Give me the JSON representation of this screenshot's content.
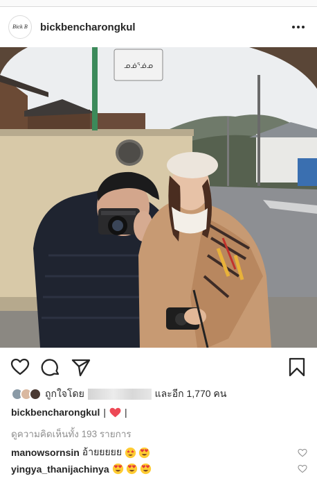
{
  "post": {
    "username": "bickbencharongkul",
    "avatar_text": "Bick B",
    "more_icon": "ellipsis-horizontal-icon"
  },
  "photo": {
    "sign_text": "ᓄᓅᕐᓅᓄ"
  },
  "actions": {
    "icons": [
      "heart-outline-icon",
      "comment-bubble-icon",
      "share-paper-plane-icon",
      "bookmark-icon"
    ]
  },
  "likes": {
    "prefix": "ถูกใจโดย",
    "suffix": "และอีก 1,770 คน"
  },
  "caption": {
    "username": "bickbencharongkul",
    "separator_1": "|",
    "separator_2": "|",
    "emoji": "red-heart"
  },
  "view_comments": "ดูความคิดเห็นทั้ง 193 รายการ",
  "comments": [
    {
      "username": "manowsornsin",
      "text": "อ้ายยยยย",
      "emojis": [
        "star-struck",
        "heart-eyes"
      ]
    },
    {
      "username": "yingya_thanijachinya",
      "text": "",
      "emojis": [
        "heart-eyes",
        "heart-eyes",
        "heart-eyes"
      ]
    }
  ],
  "colors": {
    "text": "#262626",
    "muted": "#8e8e8e",
    "heart_red": "#ed4956",
    "emoji_yellow": "#ffcc33"
  }
}
